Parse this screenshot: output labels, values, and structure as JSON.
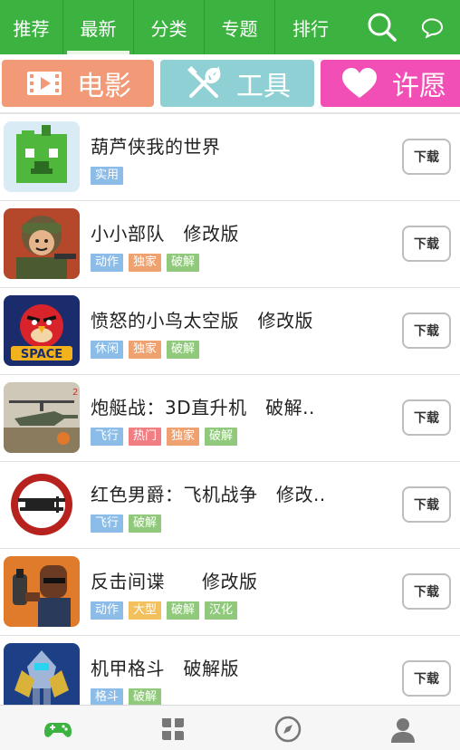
{
  "top_tabs": [
    {
      "label": "推荐"
    },
    {
      "label": "最新"
    },
    {
      "label": "分类"
    },
    {
      "label": "专题"
    },
    {
      "label": "排行"
    }
  ],
  "top_icons": [
    "search-icon",
    "chat-icon"
  ],
  "categories": [
    {
      "label": "电影",
      "icon": "film-icon",
      "color": "#f29a77"
    },
    {
      "label": "工具",
      "icon": "tools-icon",
      "color": "#8ed0d3"
    },
    {
      "label": "许愿",
      "icon": "heart-icon",
      "color": "#f24fb6"
    }
  ],
  "download_label": "下载",
  "apps": [
    {
      "title": "葫芦侠我的世界",
      "tags": [
        "实用"
      ],
      "icon": "minecraft-apple-icon"
    },
    {
      "title": "小小部队　修改版",
      "tags": [
        "动作",
        "独家",
        "破解"
      ],
      "icon": "soldier-icon"
    },
    {
      "title": "愤怒的小鸟太空版　修改版",
      "tags": [
        "休闲",
        "独家",
        "破解"
      ],
      "icon": "angry-bird-space-icon"
    },
    {
      "title": "炮艇战：3D直升机　破解..",
      "tags": [
        "飞行",
        "热门",
        "独家",
        "破解"
      ],
      "icon": "helicopter-icon"
    },
    {
      "title": "红色男爵：飞机战争　修改..",
      "tags": [
        "飞行",
        "破解"
      ],
      "icon": "biplane-icon"
    },
    {
      "title": "反击间谍　　修改版",
      "tags": [
        "动作",
        "大型",
        "破解",
        "汉化"
      ],
      "icon": "spy-icon"
    },
    {
      "title": "机甲格斗　破解版",
      "tags": [
        "格斗",
        "破解"
      ],
      "icon": "mecha-icon"
    }
  ],
  "tag_colors": {
    "实用": "#8bbde8",
    "动作": "#8bbde8",
    "休闲": "#8bbde8",
    "飞行": "#8bbde8",
    "格斗": "#8bbde8",
    "独家": "#f0a170",
    "热门": "#f17e82",
    "大型": "#f2c15e",
    "破解": "#90c97c",
    "汉化": "#90c97c"
  },
  "bottom_nav": [
    {
      "icon": "gamepad-icon",
      "active": true
    },
    {
      "icon": "grid-icon",
      "active": false
    },
    {
      "icon": "compass-icon",
      "active": false
    },
    {
      "icon": "user-icon",
      "active": false
    }
  ],
  "colors": {
    "primary": "#3cb340"
  }
}
